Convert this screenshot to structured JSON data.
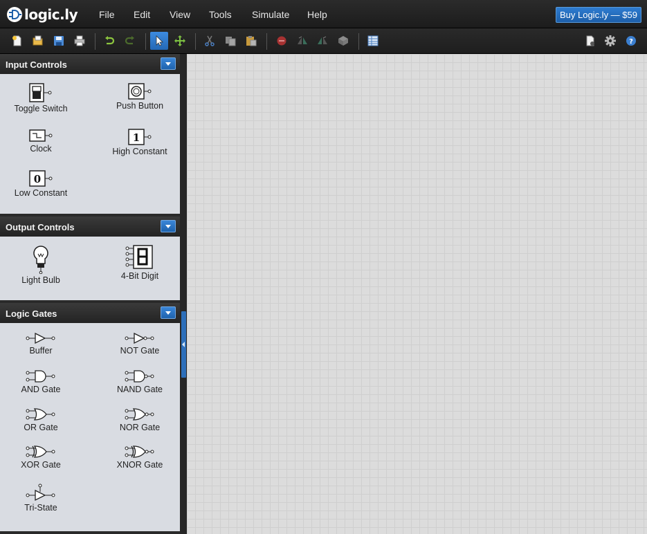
{
  "app": {
    "logo_text": "logic.ly",
    "menu": [
      "File",
      "Edit",
      "View",
      "Tools",
      "Simulate",
      "Help"
    ],
    "buy_label": "Buy Logic.ly — $59"
  },
  "toolbar": {
    "icons": [
      "new-file-icon",
      "open-folder-icon",
      "save-icon",
      "print-icon",
      "undo-icon",
      "redo-icon",
      "select-pointer-icon",
      "pan-move-icon",
      "cut-icon",
      "copy-icon",
      "paste-icon",
      "delete-icon",
      "flip-horizontal-icon",
      "flip-vertical-icon",
      "integrated-circuit-icon",
      "truth-table-icon",
      "export-icon",
      "settings-gear-icon",
      "help-icon"
    ],
    "active": "select-pointer-icon",
    "accent": "#2d74c4"
  },
  "sidebar": {
    "sections": [
      {
        "title": "Input Controls",
        "items": [
          "Toggle Switch",
          "Push Button",
          "Clock",
          "High Constant",
          "Low Constant"
        ]
      },
      {
        "title": "Output Controls",
        "items": [
          "Light Bulb",
          "4-Bit Digit"
        ]
      },
      {
        "title": "Logic Gates",
        "items": [
          "Buffer",
          "NOT Gate",
          "AND Gate",
          "NAND Gate",
          "OR Gate",
          "NOR Gate",
          "XOR Gate",
          "XNOR Gate",
          "Tri-State"
        ]
      }
    ]
  }
}
